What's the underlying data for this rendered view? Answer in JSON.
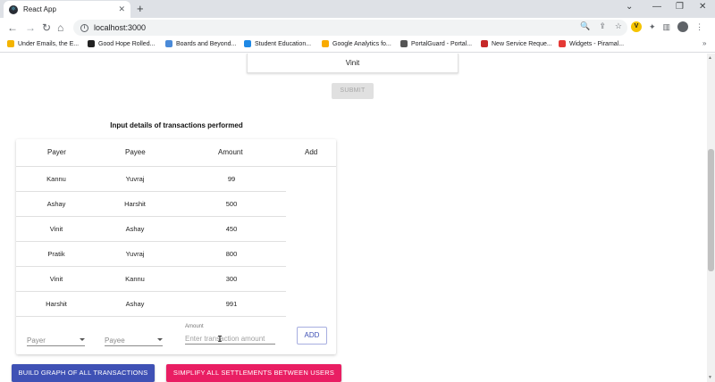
{
  "browser": {
    "tab_title": "React App",
    "tab_close": "✕",
    "new_tab": "+",
    "url": "localhost:3000",
    "window_controls": [
      "⌄",
      "—",
      "❐",
      "✕"
    ],
    "extensions": {
      "v_badge": "V"
    },
    "bookmarks": [
      {
        "label": "Under Emails, the E...",
        "color": "#f4b400"
      },
      {
        "label": "Good Hope Rolled...",
        "color": "#222222"
      },
      {
        "label": "Boards and Beyond...",
        "color": "#4a8ad8"
      },
      {
        "label": "Student Education...",
        "color": "#1e88e5"
      },
      {
        "label": "Google Analytics fo...",
        "color": "#f9ab00"
      },
      {
        "label": "PortalGuard - Portal...",
        "color": "#555555"
      },
      {
        "label": "New Service Reque...",
        "color": "#c62828"
      },
      {
        "label": "Widgets - Piramal...",
        "color": "#e53935"
      }
    ],
    "bookmarks_more": "»"
  },
  "page": {
    "selected_user": "Vinit",
    "submit_label": "SUBMIT",
    "section_title": "Input details of transactions performed",
    "table": {
      "headers": {
        "payer": "Payer",
        "payee": "Payee",
        "amount": "Amount",
        "add": "Add"
      },
      "rows": [
        {
          "payer": "Kannu",
          "payee": "Yuvraj",
          "amount": "99"
        },
        {
          "payer": "Ashay",
          "payee": "Harshit",
          "amount": "500"
        },
        {
          "payer": "Vinit",
          "payee": "Ashay",
          "amount": "450"
        },
        {
          "payer": "Pratik",
          "payee": "Yuvraj",
          "amount": "800"
        },
        {
          "payer": "Vinit",
          "payee": "Kannu",
          "amount": "300"
        },
        {
          "payer": "Harshit",
          "payee": "Ashay",
          "amount": "991"
        }
      ]
    },
    "form": {
      "payer_placeholder": "Payer",
      "payee_placeholder": "Payee",
      "amount_label": "Amount",
      "amount_placeholder": "Enter transaction amount",
      "add_label": "ADD"
    },
    "build_graph_label": "BUILD GRAPH OF ALL TRANSACTIONS",
    "simplify_label": "SIMPLIFY ALL SETTLEMENTS BETWEEN USERS"
  },
  "colors": {
    "primary": "#3f51b5",
    "secondary": "#e91e63",
    "disabled_bg": "#e0e0e0"
  }
}
